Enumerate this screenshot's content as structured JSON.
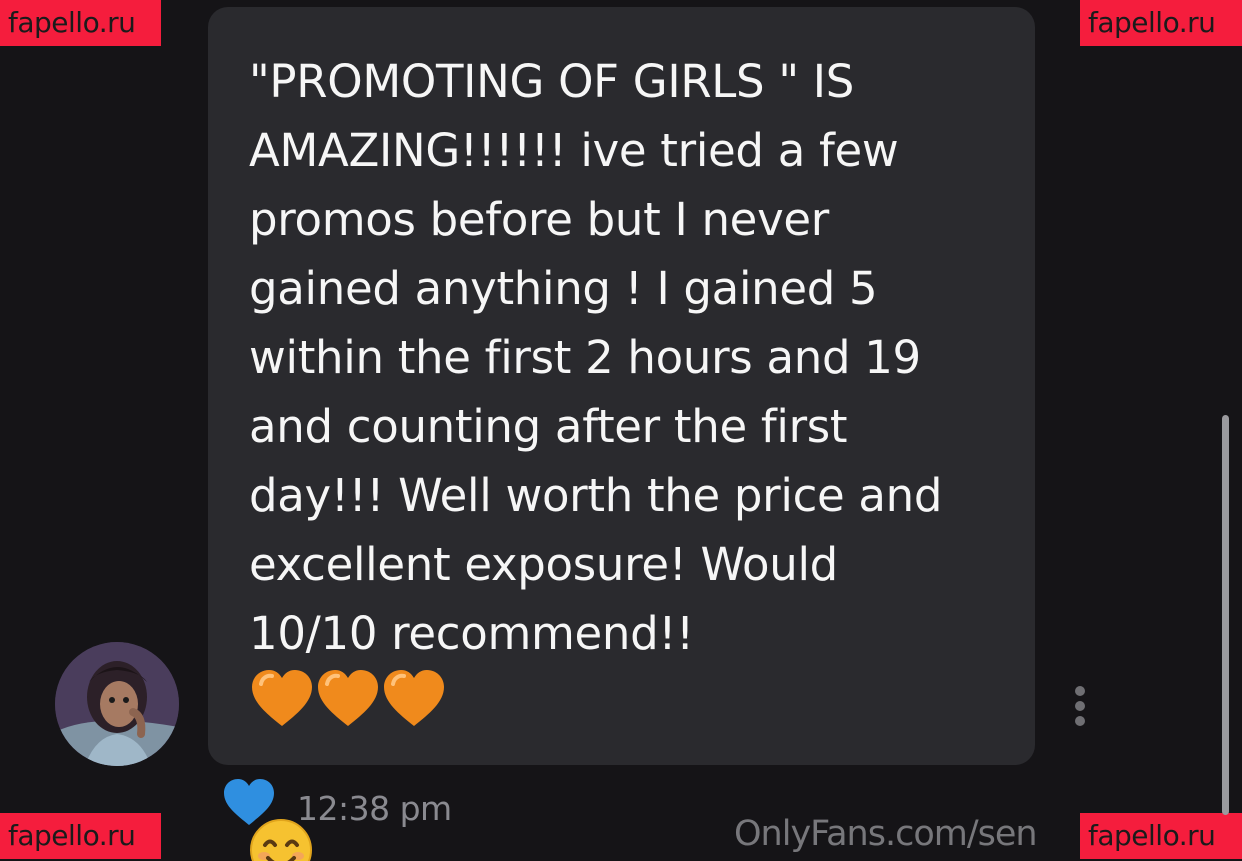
{
  "watermark": {
    "text": "fapello.ru",
    "background": "#f51d3d"
  },
  "message": {
    "text": "\"PROMOTING OF GIRLS \" IS\nAMAZING!!!!!! ive tried a few\npromos before but I never\ngained anything ! I gained 5\nwithin the first 2 hours and 19\nand counting after the first\nday!!! Well worth the price and\nexcellent exposure! Would\n10/10 recommend!!",
    "trailing_emojis": [
      "orange-heart-icon",
      "orange-heart-icon",
      "orange-heart-icon",
      "smiling-face-icon"
    ],
    "time": "12:38 pm",
    "liked": true
  },
  "footer": {
    "url_text": "OnlyFans.com/sen"
  },
  "colors": {
    "background": "#151417",
    "bubble": "#2a2a2e",
    "message_text": "#f6f6f6",
    "timestamp": "#8a8a90",
    "like_heart": "#2f8fe0",
    "orange_heart": "#f08a1c",
    "smiley": "#f6c230"
  }
}
